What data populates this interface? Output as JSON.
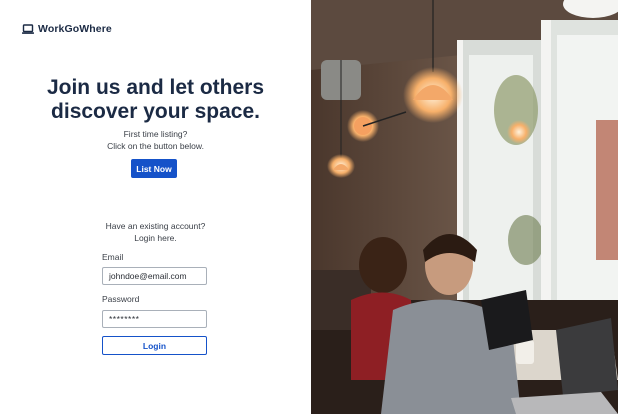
{
  "brand": {
    "name": "WorkGoWhere",
    "icon": "laptop-icon"
  },
  "hero": {
    "headline_line1": "Join us and let others",
    "headline_line2": "discover your space.",
    "sub_line1": "First time listing?",
    "sub_line2": "Click on the button below.",
    "list_button": "List Now"
  },
  "login": {
    "prompt_line1": "Have an existing account?",
    "prompt_line2": "Login here.",
    "email_label": "Email",
    "email_value": "johndoe@email.com",
    "password_label": "Password",
    "password_value": "********",
    "login_button": "Login"
  },
  "colors": {
    "brand_dark": "#1b2a44",
    "accent": "#1552c9"
  }
}
